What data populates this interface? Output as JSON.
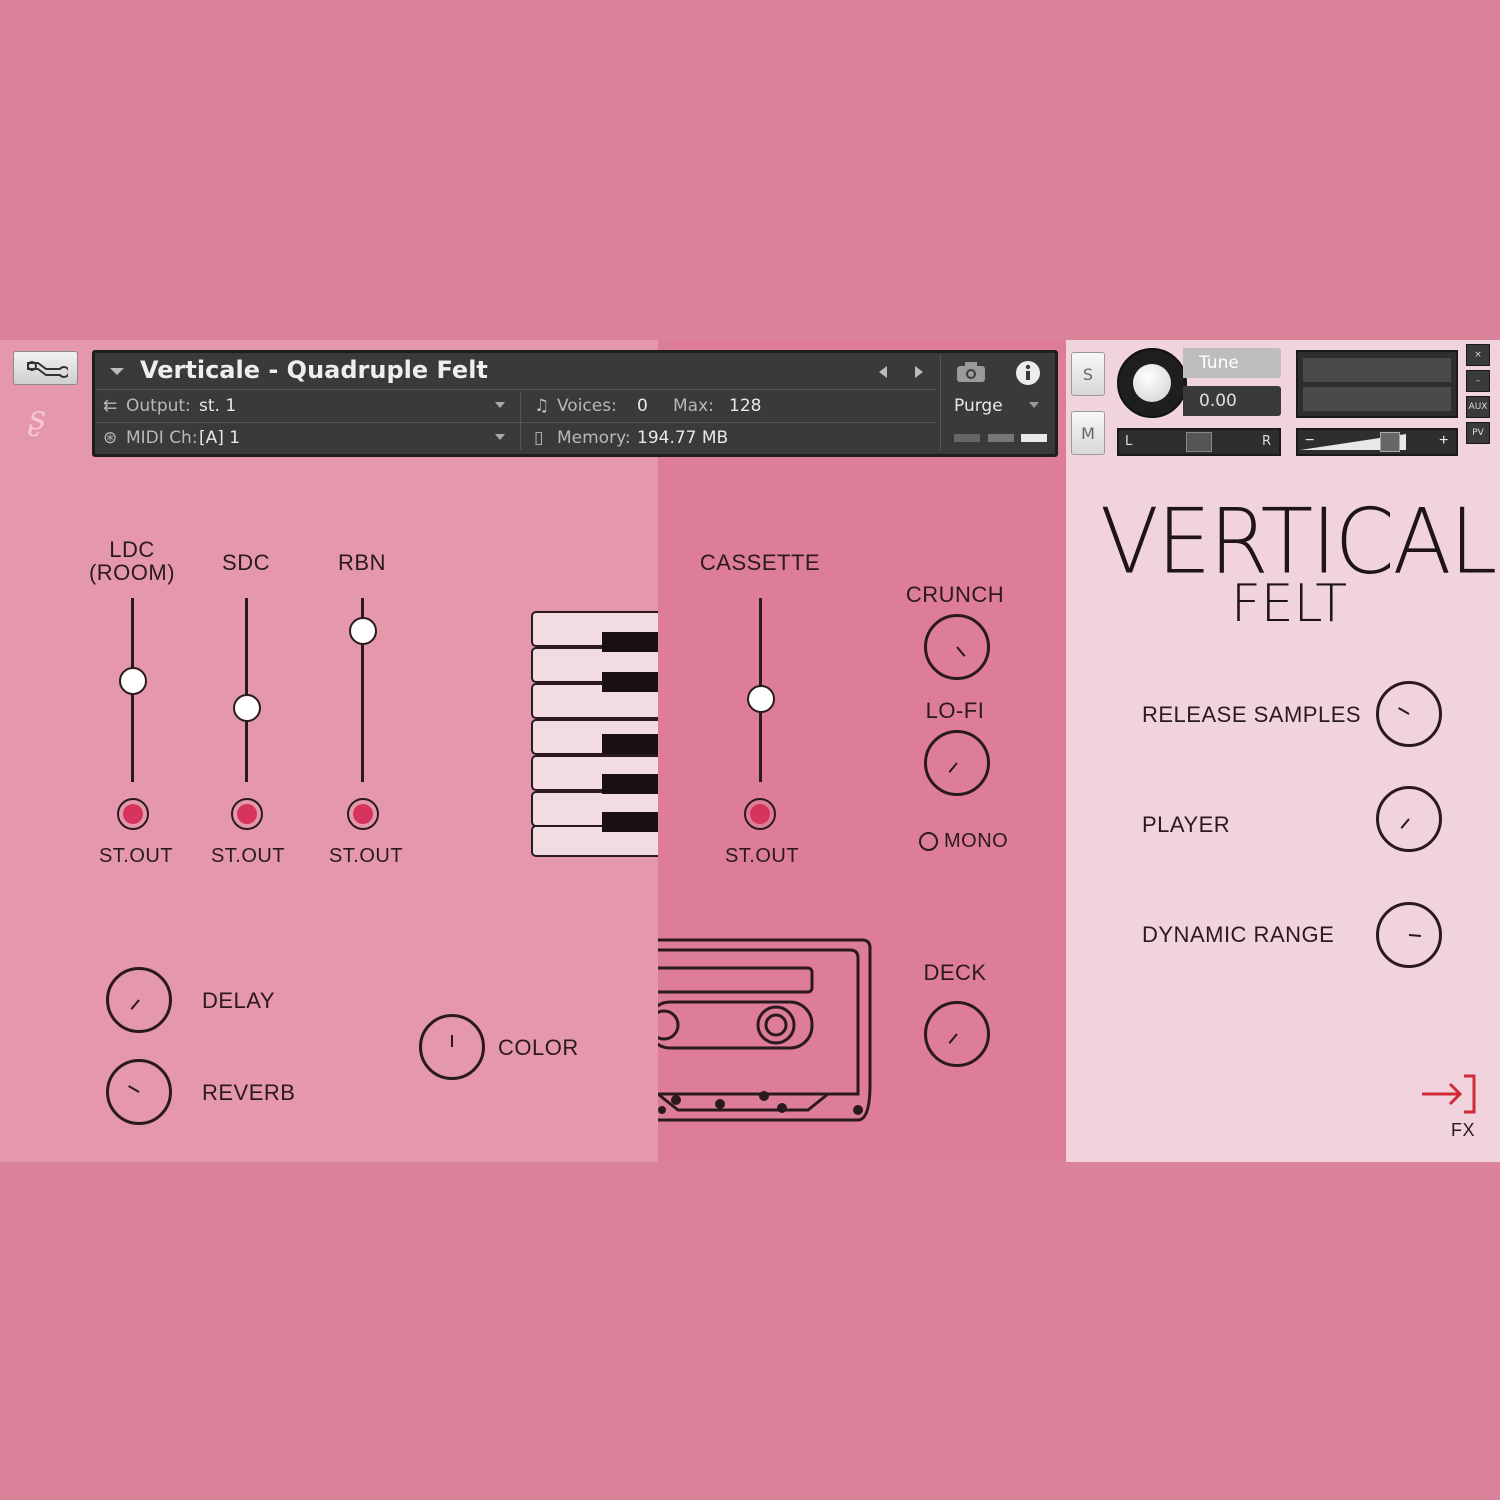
{
  "header": {
    "title": "Verticale - Quadruple Felt",
    "output_label": "Output:",
    "output_value": "st. 1",
    "midi_label": "MIDI Ch:",
    "midi_value": "[A]  1",
    "voices_label": "Voices:",
    "voices_value": "0",
    "max_label": "Max:",
    "max_value": "128",
    "memory_label": "Memory:",
    "memory_value": "194.77 MB",
    "purge_label": "Purge"
  },
  "side": {
    "solo_label": "S",
    "mute_label": "M",
    "tune_label": "Tune",
    "tune_value": "0.00",
    "pan_left": "L",
    "pan_right": "R",
    "vol_minus": "−",
    "vol_plus": "+",
    "aux_label": "AUX",
    "pv_label": "PV",
    "close_glyph": "×",
    "min_glyph": "–"
  },
  "mics": [
    {
      "label": "LDC\n(ROOM)",
      "level": 0.55,
      "out": "ST.OUT"
    },
    {
      "label": "SDC",
      "level": 0.4,
      "out": "ST.OUT"
    },
    {
      "label": "RBN",
      "level": 0.82,
      "out": "ST.OUT"
    },
    {
      "label": "CASSETTE",
      "level": 0.45,
      "out": "ST.OUT"
    }
  ],
  "effects": {
    "crunch_label": "CRUNCH",
    "lofi_label": "LO-FI",
    "mono_label": "MONO",
    "deck_label": "DECK",
    "delay_label": "DELAY",
    "reverb_label": "REVERB",
    "color_label": "COLOR"
  },
  "right_panel": {
    "logo_title": "VERTICALE",
    "logo_sub": "FELT",
    "release_label": "RELEASE SAMPLES",
    "player_label": "PLAYER",
    "dynamic_label": "DYNAMIC RANGE",
    "fx_label": "FX"
  },
  "colors": {
    "background": "#d9829a",
    "left_panel": "#e597ac",
    "mid_panel": "#de7d98",
    "right_panel": "#f0d3dc",
    "accent_red": "#d6345d",
    "fx_arrow": "#d12a3a"
  }
}
